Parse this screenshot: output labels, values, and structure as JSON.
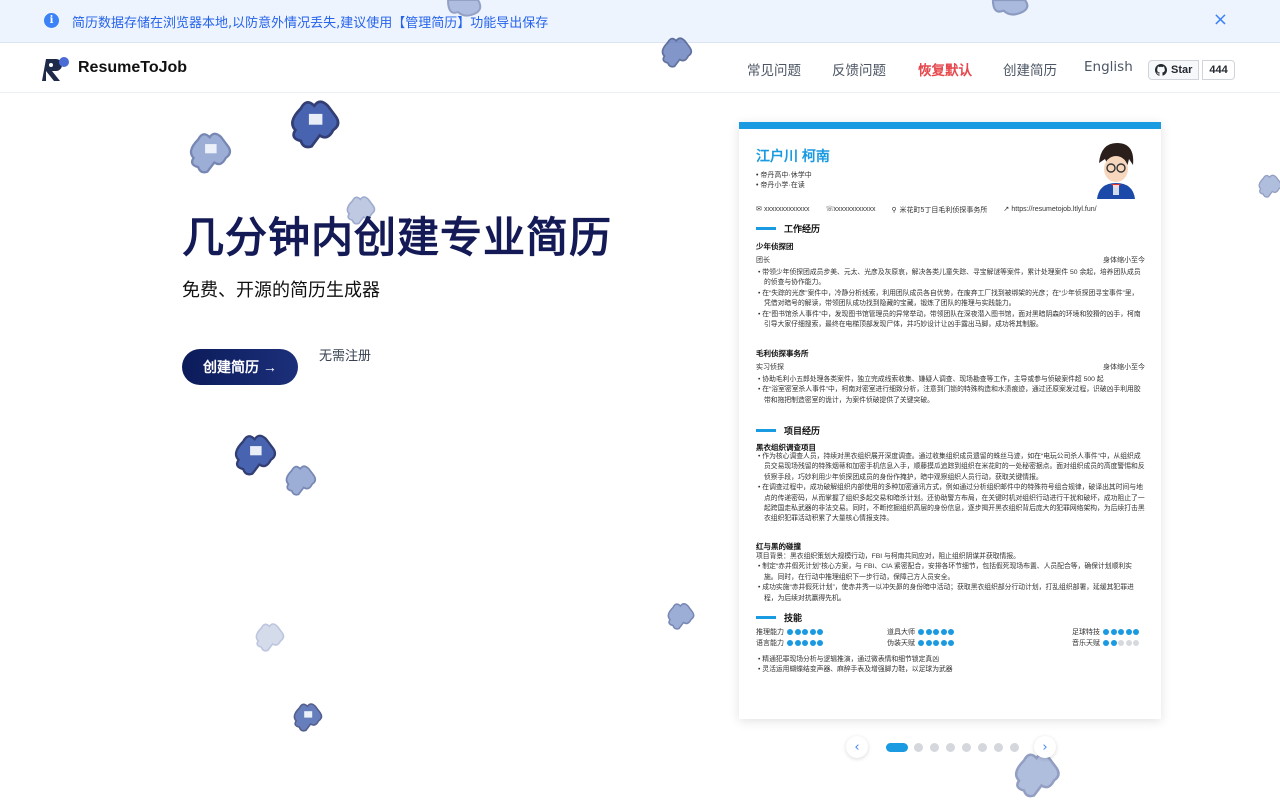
{
  "notice": {
    "text": "简历数据存储在浏览器本地,以防意外情况丢失,建议使用【管理简历】功能导出保存",
    "close": "×"
  },
  "header": {
    "brand": "ResumeToJob",
    "nav": [
      "常见问题",
      "反馈问题",
      "恢复默认",
      "创建简历",
      "English"
    ],
    "github_star": "Star",
    "github_count": "444"
  },
  "hero": {
    "title": "几分钟内创建专业简历",
    "subtitle": "免费、开源的简历生成器",
    "cta": "创建简历 →",
    "note": "无需注册"
  },
  "resume": {
    "name": "江户川 柯南",
    "lines": [
      "• 帝丹高中·休学中",
      "• 帝丹小学·在读"
    ],
    "contacts": [
      "xxxxxxxxxxxxx",
      "xxxxxxxxxxxx",
      "米花町5丁目毛利侦探事务所",
      "https://resumetojob.ltlyl.fun/"
    ],
    "sections": {
      "work": "工作经历",
      "project": "项目经历",
      "skills": "技能"
    },
    "work": [
      {
        "org": "少年侦探团",
        "role": "团长",
        "period": "身体缩小至今",
        "bullets": [
          "• 带领少年侦探团成员步美、元太、光彦及灰原哀，解决各类儿童失踪、寻宝解谜等案件，累计处理案件 50 余起，培养团队成员的侦查与协作能力。",
          "• 在“失踪的光彦”案件中，冷静分析线索，利用团队成员各自优势，在废弃工厂找到被绑架的光彦；在“少年侦探团寻宝事件”里，凭借对暗号的解读，带领团队成功找到隐藏的宝藏，锻炼了团队的推理与实践能力。",
          "• 在“图书馆杀人事件”中，发现图书馆管理员的异常举动，带领团队在深夜潜入图书馆，面对黑暗阴森的环境和狡猾的凶手，柯南引导大家仔细搜索，最终在电梯顶部发现尸体，并巧妙设计让凶手露出马脚，成功将其制服。"
        ]
      },
      {
        "org": "毛利侦探事务所",
        "role": "实习侦探",
        "period": "身体缩小至今",
        "bullets": [
          "• 协助毛利小五郎处理各类案件，独立完成线索收集、嫌疑人调查、现场勘查等工作，主导或参与侦破案件超 500 起",
          "• 在“浴室密室杀人事件”中，柯南对密室进行细致分析，注意到门锁的特殊构造和水渍痕迹，通过还原案发过程，识破凶手利用胶带和拖把制造密室的诡计，为案件侦破提供了关键突破。"
        ]
      }
    ],
    "projects": [
      {
        "name": "黑衣组织调查项目",
        "bullets": [
          "• 作为核心调查人员，持续对黑衣组织展开深度调查。通过收集组织成员遗留的蛛丝马迹，如在“电玩公司杀人事件”中，从组织成员交易现场残留的特殊烟蒂和加密手机信息入手，顺藤摸瓜追踪到组织在米花町的一处秘密据点。面对组织成员的高度警惕和反侦察手段，巧妙利用少年侦探团成员的身份作掩护，暗中观察组织人员行动，获取关键情报。",
          "• 在调查过程中，成功破解组织内部使用的多种加密通讯方式，例如通过分析组织邮件中的特殊符号组合规律，破译出其时间与地点的传递密码，从而掌握了组织多起交易和暗杀计划。还协助警方布局，在关键时机对组织行动进行干扰和破坏，成功阻止了一起跨国走私武器的非法交易。同时，不断挖掘组织高层的身份信息，逐步揭开黑衣组织背后庞大的犯罪网络架构，为后续打击黑衣组织犯罪活动积累了大量核心情报支持。"
        ]
      },
      {
        "name": "红与黑的碰撞",
        "intro": "项目背景：黑衣组织策划大规模行动，FBI 与柯南共同应对，阻止组织阴谋并获取情报。",
        "bullets": [
          "• 制定“赤井假死计划”核心方案，与 FBI、CIA 紧密配合，安排各环节细节，包括假死现场布置、人员配合等，确保计划顺利实施。同时，在行动中推理组织下一步行动，保障己方人员安全。",
          "• 成功实施“赤井假死计划”，使赤井秀一以冲矢昴的身份暗中活动；获取黑衣组织部分行动计划，打乱组织部署，延缓其犯罪进程，为后续对抗赢得先机。"
        ]
      }
    ],
    "skills": [
      {
        "name": "推理能力",
        "level": 5
      },
      {
        "name": "道具大师",
        "level": 5
      },
      {
        "name": "足球特技",
        "level": 5
      },
      {
        "name": "语言能力",
        "level": 5
      },
      {
        "name": "伪装天赋",
        "level": 5
      },
      {
        "name": "音乐天赋",
        "level": 2
      }
    ],
    "skill_notes": [
      "• 精通犯罪现场分析与逻辑推演，通过微表情和细节锁定真凶",
      "• 灵活运用蝴蝶结变声器、麻醉手表及增强脚力鞋，以足球为武器"
    ]
  },
  "carousel": {
    "prev": "‹",
    "next": "›",
    "count": 8,
    "active": 0
  },
  "colors": {
    "accent": "#1a9ae0",
    "brand_dark": "#141a56",
    "notice_text": "#2563eb",
    "danger": "#e5484d"
  },
  "icons": [
    "info-icon",
    "close-icon",
    "logo-icon",
    "github-icon",
    "arrow-right-icon",
    "email-icon",
    "phone-icon",
    "location-icon",
    "link-icon",
    "chevron-left-icon",
    "chevron-right-icon",
    "puzzle-piece-icon"
  ]
}
